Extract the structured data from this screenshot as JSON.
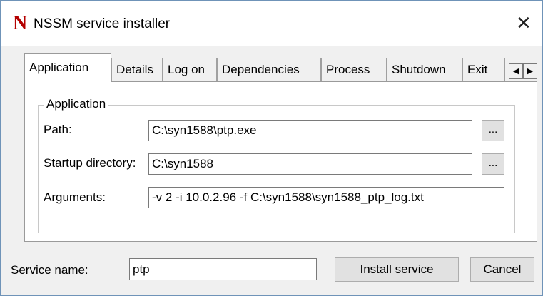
{
  "window": {
    "title": "NSSM service installer",
    "icon_letter": "N",
    "close_glyph": "✕"
  },
  "tabs": [
    {
      "label": "Application",
      "active": true
    },
    {
      "label": "Details",
      "active": false
    },
    {
      "label": "Log on",
      "active": false
    },
    {
      "label": "Dependencies",
      "active": false
    },
    {
      "label": "Process",
      "active": false
    },
    {
      "label": "Shutdown",
      "active": false
    },
    {
      "label": "Exit",
      "active": false
    }
  ],
  "tab_scroll": {
    "left_glyph": "◀",
    "right_glyph": "▶"
  },
  "application": {
    "group_label": "Application",
    "path_label": "Path:",
    "path_value": "C:\\syn1588\\ptp.exe",
    "startup_label": "Startup directory:",
    "startup_value": "C:\\syn1588",
    "arguments_label": "Arguments:",
    "arguments_value": "-v 2 -i 10.0.2.96 -f C:\\syn1588\\syn1588_ptp_log.txt",
    "browse_label": "..."
  },
  "footer": {
    "service_name_label": "Service name:",
    "service_name_value": "ptp",
    "install_label": "Install service",
    "cancel_label": "Cancel"
  },
  "colors": {
    "icon": "#b40000",
    "window_bg": "#f0f0f0",
    "button_bg": "#e1e1e1"
  }
}
